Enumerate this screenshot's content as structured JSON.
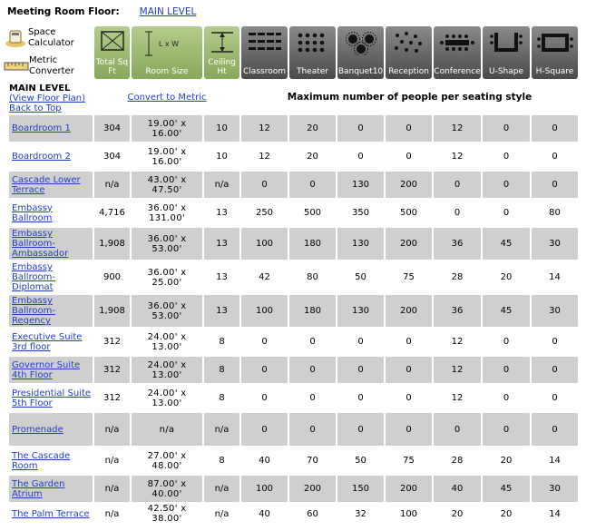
{
  "floor": {
    "label": "Meeting Room Floor:",
    "level_link": "MAIN LEVEL"
  },
  "tools": {
    "space_calculator": "Space Calculator",
    "metric_converter": "Metric Converter"
  },
  "columns": {
    "total_sqft": "Total Sq Ft",
    "room_size": "Room Size",
    "room_size_glyph": "L x W",
    "ceiling_ht": "Ceiling Ht",
    "classroom": "Classroom",
    "theater": "Theater",
    "banquet": "Banquet10",
    "reception": "Reception",
    "conference": "Conference",
    "ushape": "U-Shape",
    "hsquare": "H-Square"
  },
  "subheader": {
    "main_level": "MAIN LEVEL",
    "view_floor_plan": "(View Floor Plan)",
    "back_to_top": "Back to Top",
    "convert_to_metric": "Convert to Metric",
    "max_people": "Maximum number of people per seating style"
  },
  "rooms": [
    {
      "name": "Boardroom 1",
      "sqft": "304",
      "size": "19.00' x 16.00'",
      "ceiling": "10",
      "classroom": "12",
      "theater": "20",
      "banquet": "0",
      "reception": "0",
      "conference": "12",
      "ushape": "0",
      "hsquare": "0"
    },
    {
      "name": "Boardroom 2",
      "sqft": "304",
      "size": "19.00' x 16.00'",
      "ceiling": "10",
      "classroom": "12",
      "theater": "20",
      "banquet": "0",
      "reception": "0",
      "conference": "12",
      "ushape": "0",
      "hsquare": "0"
    },
    {
      "name": "Cascade Lower Terrace",
      "sqft": "n/a",
      "size": "43.00' x 47.50'",
      "ceiling": "n/a",
      "classroom": "0",
      "theater": "0",
      "banquet": "130",
      "reception": "200",
      "conference": "0",
      "ushape": "0",
      "hsquare": "0"
    },
    {
      "name": "Embassy Ballroom",
      "sqft": "4,716",
      "size": "36.00' x 131.00'",
      "ceiling": "13",
      "classroom": "250",
      "theater": "500",
      "banquet": "350",
      "reception": "500",
      "conference": "0",
      "ushape": "0",
      "hsquare": "80"
    },
    {
      "name": "Embassy Ballroom-Ambassador",
      "sqft": "1,908",
      "size": "36.00' x 53.00'",
      "ceiling": "13",
      "classroom": "100",
      "theater": "180",
      "banquet": "130",
      "reception": "200",
      "conference": "36",
      "ushape": "45",
      "hsquare": "30"
    },
    {
      "name": "Embassy Ballroom-Diplomat",
      "sqft": "900",
      "size": "36.00' x 25.00'",
      "ceiling": "13",
      "classroom": "42",
      "theater": "80",
      "banquet": "50",
      "reception": "75",
      "conference": "28",
      "ushape": "20",
      "hsquare": "14"
    },
    {
      "name": "Embassy Ballroom-Regency",
      "sqft": "1,908",
      "size": "36.00' x 53.00'",
      "ceiling": "13",
      "classroom": "100",
      "theater": "180",
      "banquet": "130",
      "reception": "200",
      "conference": "36",
      "ushape": "45",
      "hsquare": "30"
    },
    {
      "name": "Executive Suite 3rd floor",
      "sqft": "312",
      "size": "24.00' x 13.00'",
      "ceiling": "8",
      "classroom": "0",
      "theater": "0",
      "banquet": "0",
      "reception": "0",
      "conference": "12",
      "ushape": "0",
      "hsquare": "0"
    },
    {
      "name": "Governor Suite 4th Floor",
      "sqft": "312",
      "size": "24.00' x 13.00'",
      "ceiling": "8",
      "classroom": "0",
      "theater": "0",
      "banquet": "0",
      "reception": "0",
      "conference": "12",
      "ushape": "0",
      "hsquare": "0"
    },
    {
      "name": "Presidential Suite 5th Floor",
      "sqft": "312",
      "size": "24.00' x 13.00'",
      "ceiling": "8",
      "classroom": "0",
      "theater": "0",
      "banquet": "0",
      "reception": "0",
      "conference": "12",
      "ushape": "0",
      "hsquare": "0"
    },
    {
      "name": "Promenade",
      "sqft": "n/a",
      "size": "n/a",
      "ceiling": "n/a",
      "classroom": "0",
      "theater": "0",
      "banquet": "0",
      "reception": "0",
      "conference": "0",
      "ushape": "0",
      "hsquare": "0"
    },
    {
      "name": "The Cascade Room",
      "sqft": "n/a",
      "size": "27.00' x 48.00'",
      "ceiling": "8",
      "classroom": "40",
      "theater": "70",
      "banquet": "50",
      "reception": "75",
      "conference": "28",
      "ushape": "20",
      "hsquare": "14"
    },
    {
      "name": "The Garden Atrium",
      "sqft": "n/a",
      "size": "87.00' x 40.00'",
      "ceiling": "n/a",
      "classroom": "100",
      "theater": "200",
      "banquet": "150",
      "reception": "200",
      "conference": "40",
      "ushape": "45",
      "hsquare": "30"
    },
    {
      "name": "The Palm Terrace",
      "sqft": "n/a",
      "size": "42.50' x 38.00'",
      "ceiling": "n/a",
      "classroom": "40",
      "theater": "60",
      "banquet": "32",
      "reception": "100",
      "conference": "20",
      "ushape": "20",
      "hsquare": "14"
    }
  ]
}
